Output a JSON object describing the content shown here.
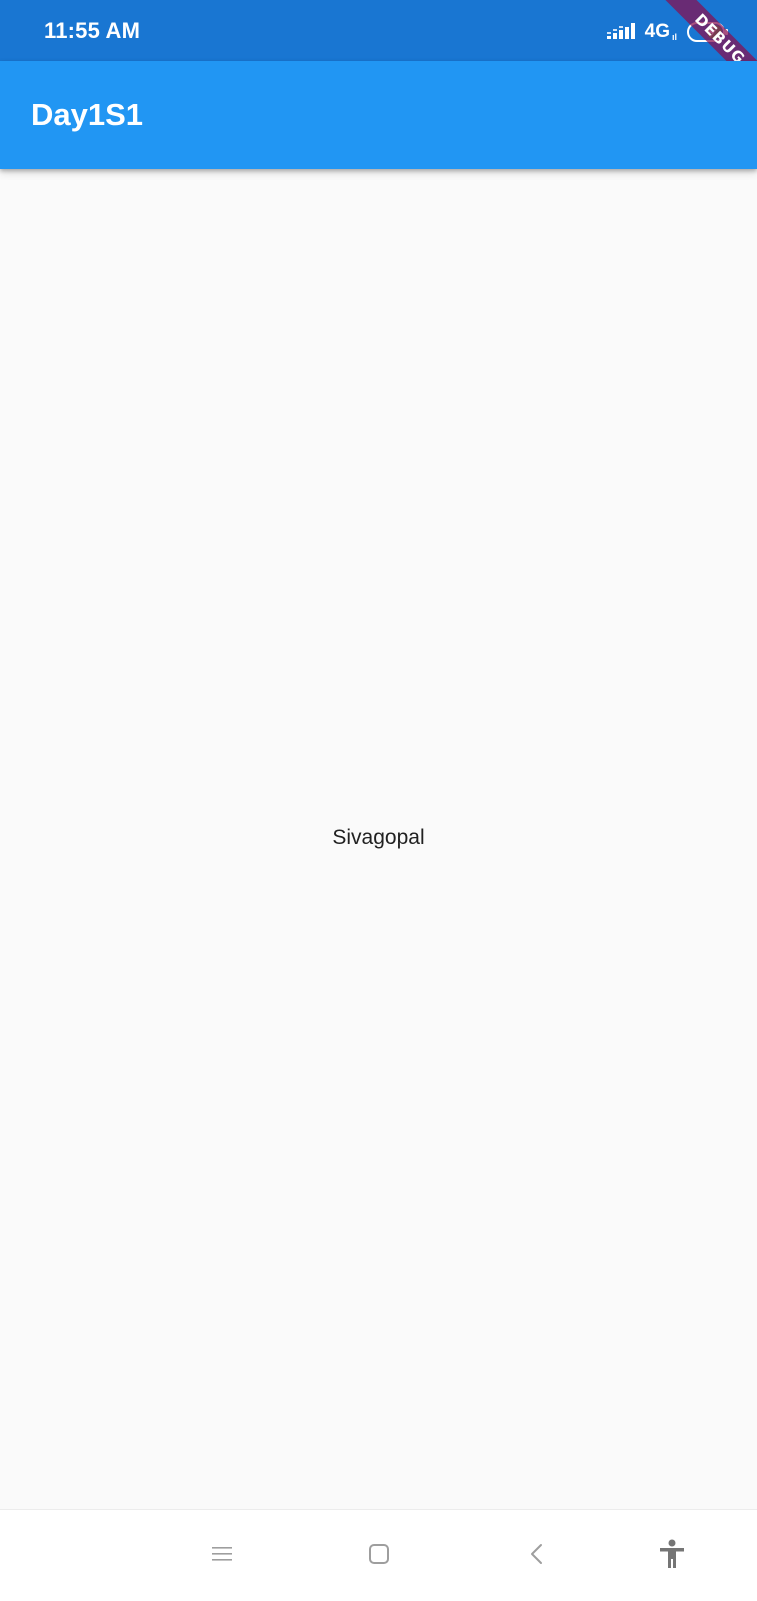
{
  "status_bar": {
    "time": "11:55 AM",
    "network": "4G",
    "network_sub": "ıl",
    "signal_icon": "signal-bars-icon",
    "battery_icon": "battery-icon",
    "bg_color": "#1976d2"
  },
  "debug_banner": {
    "label": "DEBUG",
    "color": "#880e4f"
  },
  "app_bar": {
    "title": "Day1S1",
    "bg_color": "#2196f3"
  },
  "body": {
    "text": "Sivagopal",
    "bg_color": "#fafafa"
  },
  "nav_bar": {
    "buttons": [
      {
        "name": "recents",
        "icon": "menu-lines-icon"
      },
      {
        "name": "home",
        "icon": "rounded-square-icon"
      },
      {
        "name": "back",
        "icon": "chevron-left-icon"
      },
      {
        "name": "accessibility",
        "icon": "accessibility-icon"
      }
    ]
  }
}
